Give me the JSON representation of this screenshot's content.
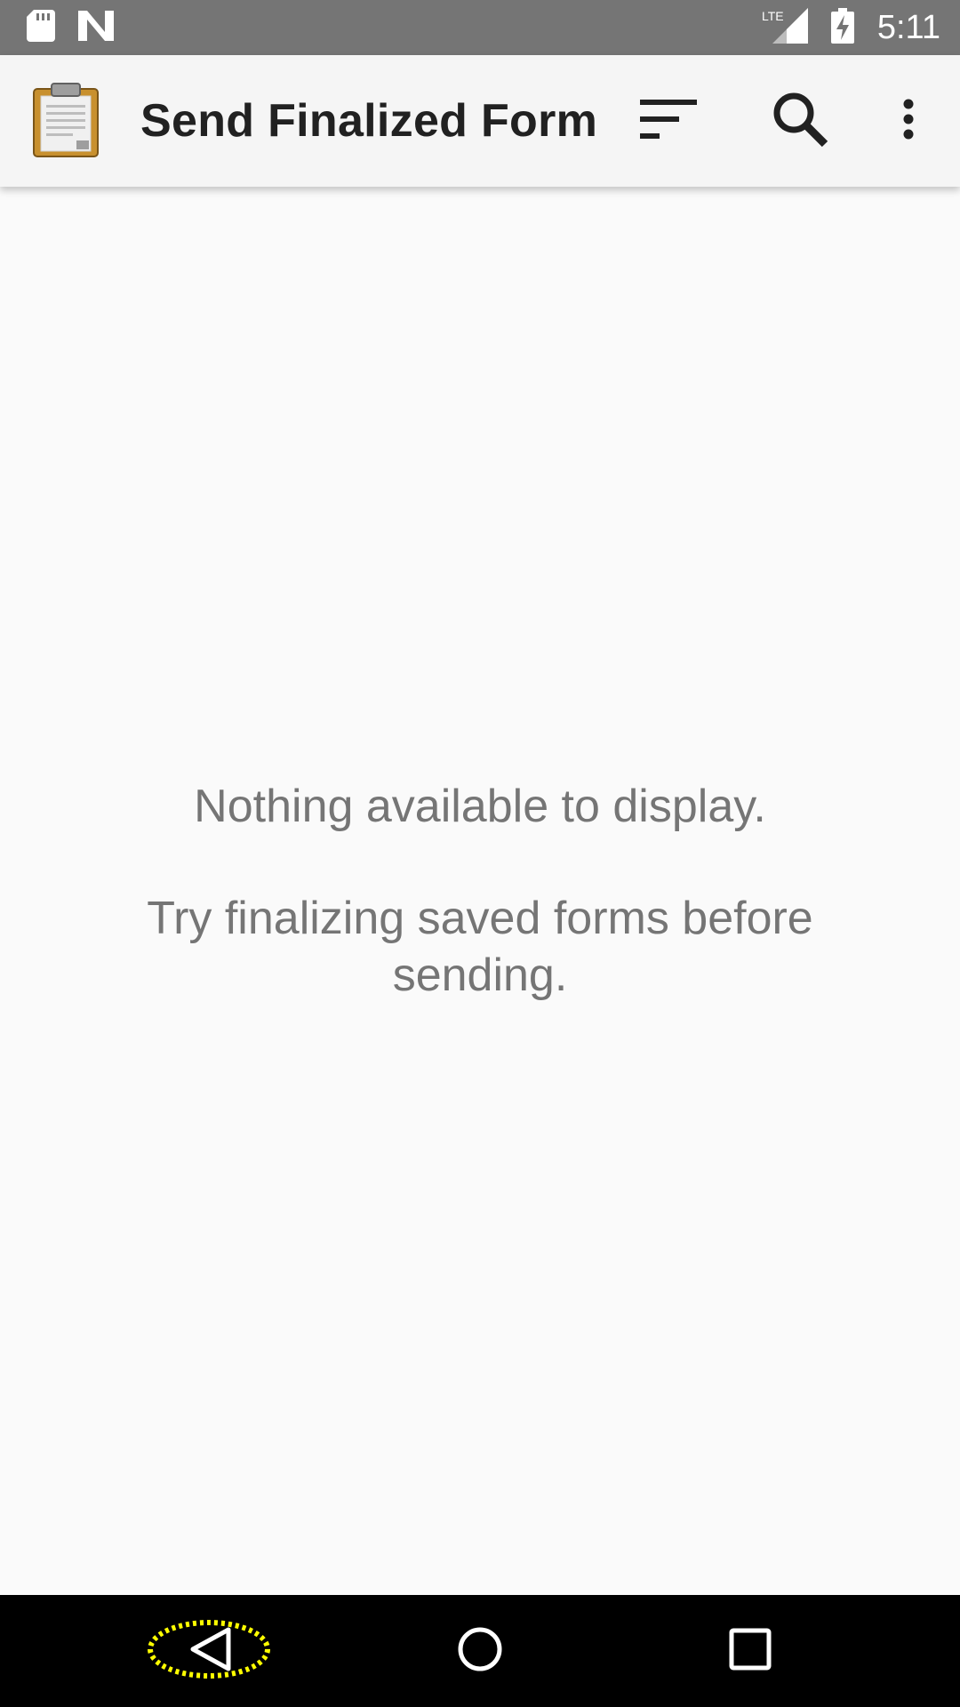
{
  "status_bar": {
    "time": "5:11",
    "network": "LTE",
    "left_icons": [
      "sd-card-icon",
      "n-notification-icon"
    ],
    "right_icons": [
      "lte-signal-icon",
      "battery-charging-icon"
    ]
  },
  "app_bar": {
    "title": "Send Finalized Form",
    "logo_icon": "clipboard-icon",
    "actions": [
      "sort-icon",
      "search-icon",
      "overflow-menu-icon"
    ]
  },
  "empty_state": {
    "message": "Nothing available to display.",
    "hint": "Try finalizing saved forms before sending."
  },
  "nav_bar": {
    "buttons": [
      "back-icon",
      "home-icon",
      "recents-icon"
    ],
    "highlight_color": "#ffff00"
  },
  "colors": {
    "status_bar": "#757575",
    "app_bar": "#f5f5f5",
    "background": "#fafafa",
    "text_primary": "#212121",
    "text_secondary": "#757575",
    "nav_bar": "#000000",
    "clipboard_board": "#c8902e"
  }
}
